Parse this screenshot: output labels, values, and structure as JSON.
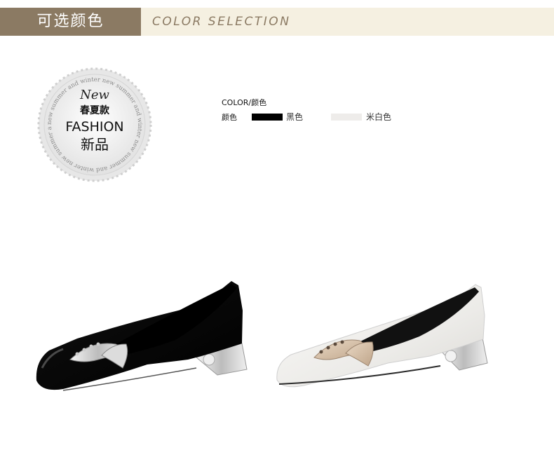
{
  "header": {
    "title_cn": "可选颜色",
    "title_en": "COLOR SELECTION"
  },
  "badge": {
    "script_word": "New",
    "season_cn": "春夏款",
    "fashion": "FASHION",
    "new_cn": "新品",
    "ring_text": "new summer and winter new summer and winter new summer and winter new summer and winter"
  },
  "colors": {
    "title": "COLOR/颜色",
    "row_label": "颜色",
    "options": [
      {
        "name": "黑色",
        "hex": "#000000"
      },
      {
        "name": "米白色",
        "hex": "#eeecea"
      }
    ]
  },
  "products": [
    {
      "icon": "black-pump-shoe-image",
      "color": "#0c0c0c"
    },
    {
      "icon": "white-pump-shoe-image",
      "color": "#f0efec"
    }
  ]
}
